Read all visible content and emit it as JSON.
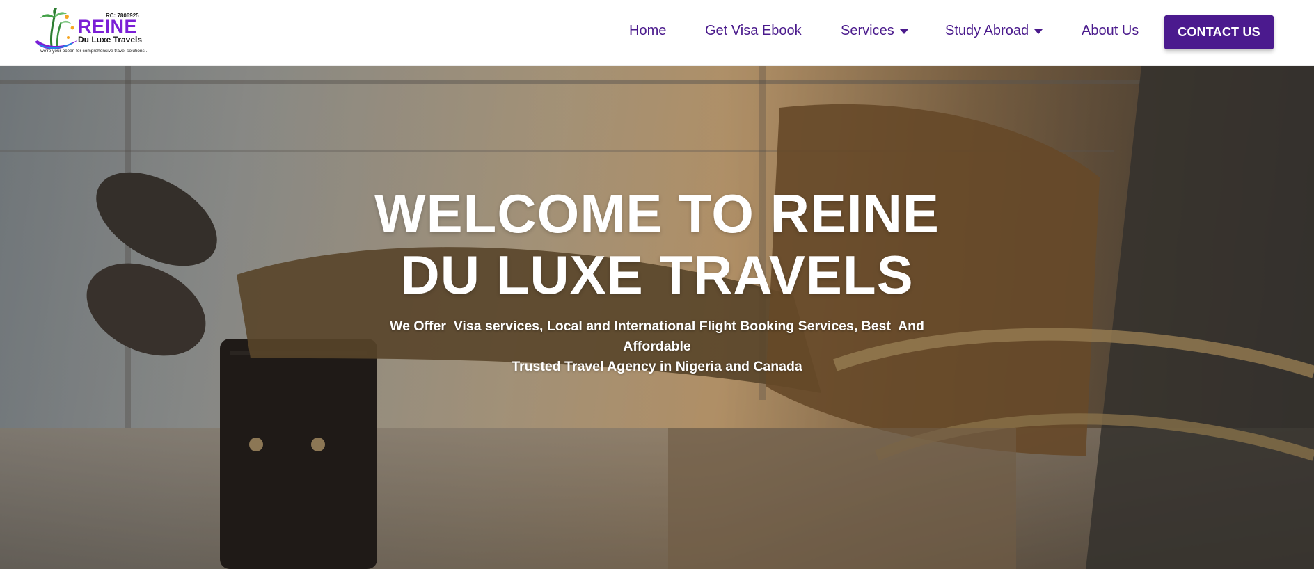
{
  "logo": {
    "rc": "RC: 7806925",
    "brand": "REINE",
    "brand_sub": "Du Luxe Travels",
    "tagline": "we're your ocean for comprehensive travel solutions..."
  },
  "nav": {
    "home": "Home",
    "ebook": "Get Visa Ebook",
    "services": "Services",
    "study_abroad": "Study Abroad",
    "about": "About Us",
    "contact": "CONTACT US"
  },
  "hero": {
    "title_line1": "WELCOME TO REINE",
    "title_line2": "DU LUXE TRAVELS",
    "sub_line1": "We Offer  Visa services, Local and International Flight Booking Services, Best  And",
    "sub_line2": "Affordable",
    "sub_line3": "Trusted Travel Agency in Nigeria and Canada"
  },
  "colors": {
    "brand_purple": "#4b1a8e",
    "logo_purple": "#7b1fd6",
    "nav_text": "#4a1a8c"
  },
  "icons": {
    "caret": "caret-down-icon",
    "logo": "palm-tree-logo-icon"
  }
}
